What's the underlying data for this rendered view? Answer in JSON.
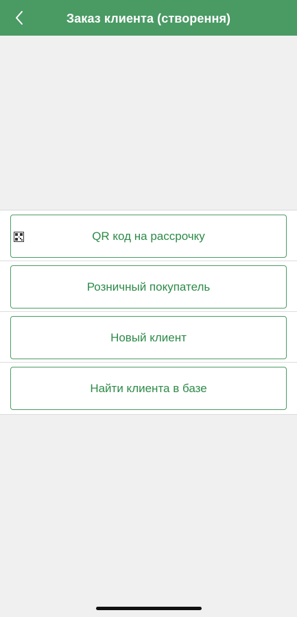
{
  "header": {
    "title": "Заказ клиента (створення)",
    "background_color": "#4a9a64",
    "back_icon": "chevron-left-icon"
  },
  "options": [
    {
      "label": "QR код на рассрочку",
      "icon": "qr-code-icon"
    },
    {
      "label": "Розничный покупатель"
    },
    {
      "label": "Новый клиент"
    },
    {
      "label": "Найти клиента в базе"
    }
  ],
  "colors": {
    "accent": "#2c8a47",
    "page_background": "#f0f0f0"
  }
}
